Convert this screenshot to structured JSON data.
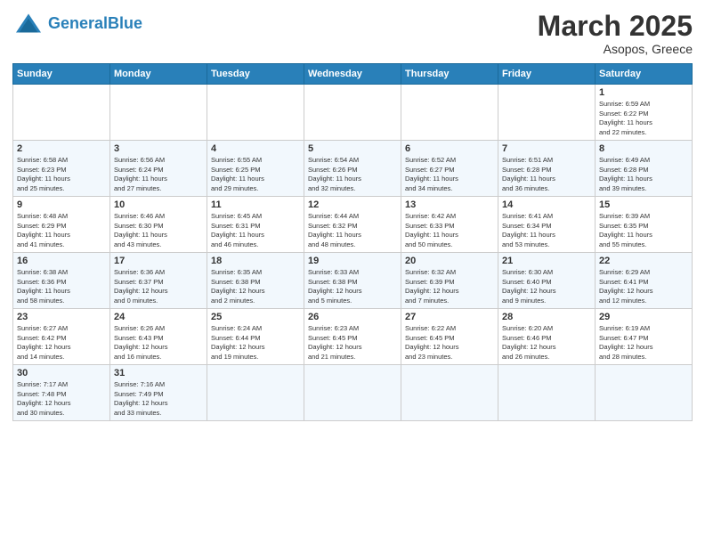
{
  "header": {
    "logo_general": "General",
    "logo_blue": "Blue",
    "title": "March 2025",
    "subtitle": "Asopos, Greece"
  },
  "weekdays": [
    "Sunday",
    "Monday",
    "Tuesday",
    "Wednesday",
    "Thursday",
    "Friday",
    "Saturday"
  ],
  "weeks": [
    [
      {
        "day": "",
        "info": ""
      },
      {
        "day": "",
        "info": ""
      },
      {
        "day": "",
        "info": ""
      },
      {
        "day": "",
        "info": ""
      },
      {
        "day": "",
        "info": ""
      },
      {
        "day": "",
        "info": ""
      },
      {
        "day": "1",
        "info": "Sunrise: 6:59 AM\nSunset: 6:22 PM\nDaylight: 11 hours\nand 22 minutes."
      }
    ],
    [
      {
        "day": "2",
        "info": "Sunrise: 6:58 AM\nSunset: 6:23 PM\nDaylight: 11 hours\nand 25 minutes."
      },
      {
        "day": "3",
        "info": "Sunrise: 6:56 AM\nSunset: 6:24 PM\nDaylight: 11 hours\nand 27 minutes."
      },
      {
        "day": "4",
        "info": "Sunrise: 6:55 AM\nSunset: 6:25 PM\nDaylight: 11 hours\nand 29 minutes."
      },
      {
        "day": "5",
        "info": "Sunrise: 6:54 AM\nSunset: 6:26 PM\nDaylight: 11 hours\nand 32 minutes."
      },
      {
        "day": "6",
        "info": "Sunrise: 6:52 AM\nSunset: 6:27 PM\nDaylight: 11 hours\nand 34 minutes."
      },
      {
        "day": "7",
        "info": "Sunrise: 6:51 AM\nSunset: 6:28 PM\nDaylight: 11 hours\nand 36 minutes."
      },
      {
        "day": "8",
        "info": "Sunrise: 6:49 AM\nSunset: 6:28 PM\nDaylight: 11 hours\nand 39 minutes."
      }
    ],
    [
      {
        "day": "9",
        "info": "Sunrise: 6:48 AM\nSunset: 6:29 PM\nDaylight: 11 hours\nand 41 minutes."
      },
      {
        "day": "10",
        "info": "Sunrise: 6:46 AM\nSunset: 6:30 PM\nDaylight: 11 hours\nand 43 minutes."
      },
      {
        "day": "11",
        "info": "Sunrise: 6:45 AM\nSunset: 6:31 PM\nDaylight: 11 hours\nand 46 minutes."
      },
      {
        "day": "12",
        "info": "Sunrise: 6:44 AM\nSunset: 6:32 PM\nDaylight: 11 hours\nand 48 minutes."
      },
      {
        "day": "13",
        "info": "Sunrise: 6:42 AM\nSunset: 6:33 PM\nDaylight: 11 hours\nand 50 minutes."
      },
      {
        "day": "14",
        "info": "Sunrise: 6:41 AM\nSunset: 6:34 PM\nDaylight: 11 hours\nand 53 minutes."
      },
      {
        "day": "15",
        "info": "Sunrise: 6:39 AM\nSunset: 6:35 PM\nDaylight: 11 hours\nand 55 minutes."
      }
    ],
    [
      {
        "day": "16",
        "info": "Sunrise: 6:38 AM\nSunset: 6:36 PM\nDaylight: 11 hours\nand 58 minutes."
      },
      {
        "day": "17",
        "info": "Sunrise: 6:36 AM\nSunset: 6:37 PM\nDaylight: 12 hours\nand 0 minutes."
      },
      {
        "day": "18",
        "info": "Sunrise: 6:35 AM\nSunset: 6:38 PM\nDaylight: 12 hours\nand 2 minutes."
      },
      {
        "day": "19",
        "info": "Sunrise: 6:33 AM\nSunset: 6:38 PM\nDaylight: 12 hours\nand 5 minutes."
      },
      {
        "day": "20",
        "info": "Sunrise: 6:32 AM\nSunset: 6:39 PM\nDaylight: 12 hours\nand 7 minutes."
      },
      {
        "day": "21",
        "info": "Sunrise: 6:30 AM\nSunset: 6:40 PM\nDaylight: 12 hours\nand 9 minutes."
      },
      {
        "day": "22",
        "info": "Sunrise: 6:29 AM\nSunset: 6:41 PM\nDaylight: 12 hours\nand 12 minutes."
      }
    ],
    [
      {
        "day": "23",
        "info": "Sunrise: 6:27 AM\nSunset: 6:42 PM\nDaylight: 12 hours\nand 14 minutes."
      },
      {
        "day": "24",
        "info": "Sunrise: 6:26 AM\nSunset: 6:43 PM\nDaylight: 12 hours\nand 16 minutes."
      },
      {
        "day": "25",
        "info": "Sunrise: 6:24 AM\nSunset: 6:44 PM\nDaylight: 12 hours\nand 19 minutes."
      },
      {
        "day": "26",
        "info": "Sunrise: 6:23 AM\nSunset: 6:45 PM\nDaylight: 12 hours\nand 21 minutes."
      },
      {
        "day": "27",
        "info": "Sunrise: 6:22 AM\nSunset: 6:45 PM\nDaylight: 12 hours\nand 23 minutes."
      },
      {
        "day": "28",
        "info": "Sunrise: 6:20 AM\nSunset: 6:46 PM\nDaylight: 12 hours\nand 26 minutes."
      },
      {
        "day": "29",
        "info": "Sunrise: 6:19 AM\nSunset: 6:47 PM\nDaylight: 12 hours\nand 28 minutes."
      }
    ],
    [
      {
        "day": "30",
        "info": "Sunrise: 7:17 AM\nSunset: 7:48 PM\nDaylight: 12 hours\nand 30 minutes."
      },
      {
        "day": "31",
        "info": "Sunrise: 7:16 AM\nSunset: 7:49 PM\nDaylight: 12 hours\nand 33 minutes."
      },
      {
        "day": "",
        "info": ""
      },
      {
        "day": "",
        "info": ""
      },
      {
        "day": "",
        "info": ""
      },
      {
        "day": "",
        "info": ""
      },
      {
        "day": "",
        "info": ""
      }
    ]
  ]
}
